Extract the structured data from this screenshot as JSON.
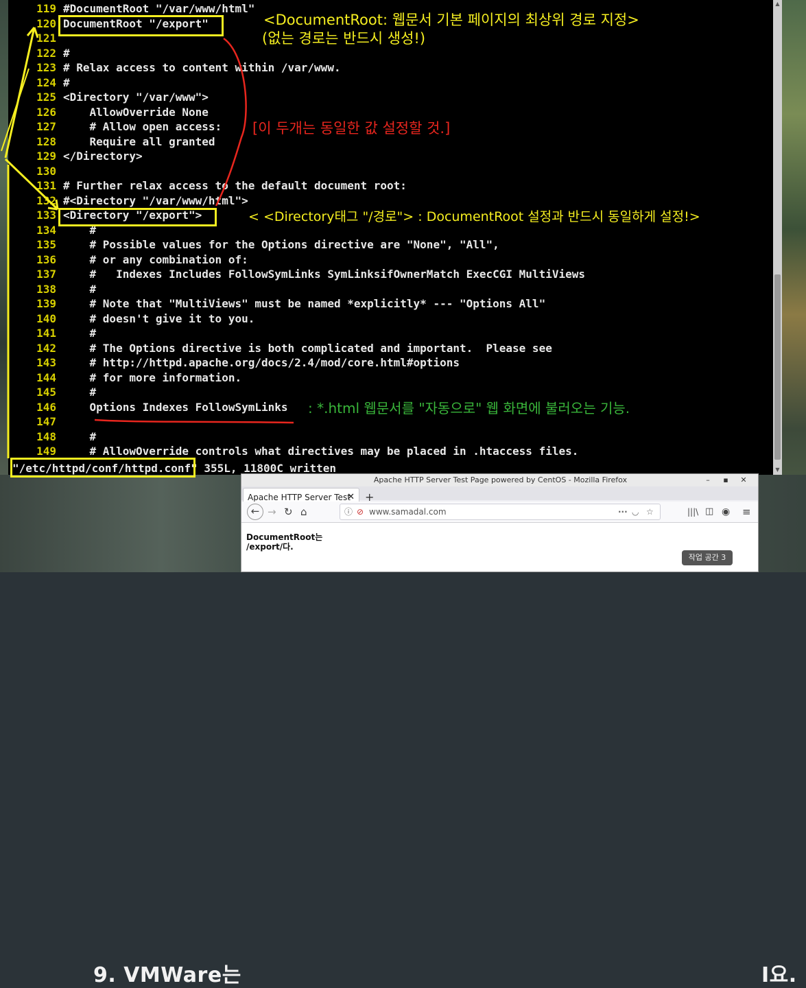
{
  "terminal": {
    "lines": [
      {
        "n": "119",
        "t": "#DocumentRoot \"/var/www/html\""
      },
      {
        "n": "120",
        "t": "DocumentRoot \"/export\""
      },
      {
        "n": "121",
        "t": ""
      },
      {
        "n": "122",
        "t": "#"
      },
      {
        "n": "123",
        "t": "# Relax access to content within /var/www."
      },
      {
        "n": "124",
        "t": "#"
      },
      {
        "n": "125",
        "t": "<Directory \"/var/www\">"
      },
      {
        "n": "126",
        "t": "    AllowOverride None"
      },
      {
        "n": "127",
        "t": "    # Allow open access:"
      },
      {
        "n": "128",
        "t": "    Require all granted"
      },
      {
        "n": "129",
        "t": "</Directory>"
      },
      {
        "n": "130",
        "t": ""
      },
      {
        "n": "131",
        "t": "# Further relax access to the default document root:"
      },
      {
        "n": "132",
        "t": "#<Directory \"/var/www/html\">"
      },
      {
        "n": "133",
        "t": "<Directory \"/export\">"
      },
      {
        "n": "134",
        "t": "    #"
      },
      {
        "n": "135",
        "t": "    # Possible values for the Options directive are \"None\", \"All\","
      },
      {
        "n": "136",
        "t": "    # or any combination of:"
      },
      {
        "n": "137",
        "t": "    #   Indexes Includes FollowSymLinks SymLinksifOwnerMatch ExecCGI MultiViews"
      },
      {
        "n": "138",
        "t": "    #"
      },
      {
        "n": "139",
        "t": "    # Note that \"MultiViews\" must be named *explicitly* --- \"Options All\""
      },
      {
        "n": "140",
        "t": "    # doesn't give it to you."
      },
      {
        "n": "141",
        "t": "    #"
      },
      {
        "n": "142",
        "t": "    # The Options directive is both complicated and important.  Please see"
      },
      {
        "n": "143",
        "t": "    # http://httpd.apache.org/docs/2.4/mod/core.html#options"
      },
      {
        "n": "144",
        "t": "    # for more information."
      },
      {
        "n": "145",
        "t": "    #"
      },
      {
        "n": "146",
        "t": "    Options Indexes FollowSymLinks"
      },
      {
        "n": "147",
        "t": ""
      },
      {
        "n": "148",
        "t": "    #"
      },
      {
        "n": "149",
        "t": "    # AllowOverride controls what directives may be placed in .htaccess files."
      }
    ],
    "status_text": "\"/etc/httpd/conf/httpd.conf\" 355L, 11800C written"
  },
  "annotations": {
    "docroot_line1": "<DocumentRoot:  웹문서 기본 페이지의 최상위 경로 지정>",
    "docroot_line2": "(없는 경로는 반드시 생성!)",
    "same_value": "[이 두개는 동일한 값 설정할 것.]",
    "directory_tag": "<  <Directory태그 \"/경로\"> :  DocumentRoot 설정과 반드시 동일하게 설정!>",
    "options_note": ": *.html 웹문서를 \"자동으로\" 웹 화면에 불러오는 기능."
  },
  "background": {
    "caption_left": "9. VMWare는",
    "caption_right": "I요."
  },
  "firefox": {
    "window_title": "Apache HTTP Server Test Page powered by CentOS - Mozilla Firefox",
    "tab_label": "Apache HTTP Server Test Pa",
    "url": "www.samadal.com",
    "content_line1": "DocumentRoot는",
    "content_line2": "/export/다.",
    "workspace_label": "작업 공간 3",
    "icons": [
      "back-icon",
      "forward-icon",
      "reload-icon",
      "home-icon",
      "info-icon",
      "menu-dots-icon",
      "pocket-icon",
      "bookmark-star-icon",
      "library-icon",
      "sidebar-icon",
      "account-icon",
      "hamburger-menu-icon"
    ]
  },
  "colors": {
    "terminal_bg": "#000000",
    "line_number": "#d8d000",
    "highlight_yellow": "#f5ee20",
    "annotation_red": "#e8261e",
    "annotation_green": "#39b53a"
  }
}
